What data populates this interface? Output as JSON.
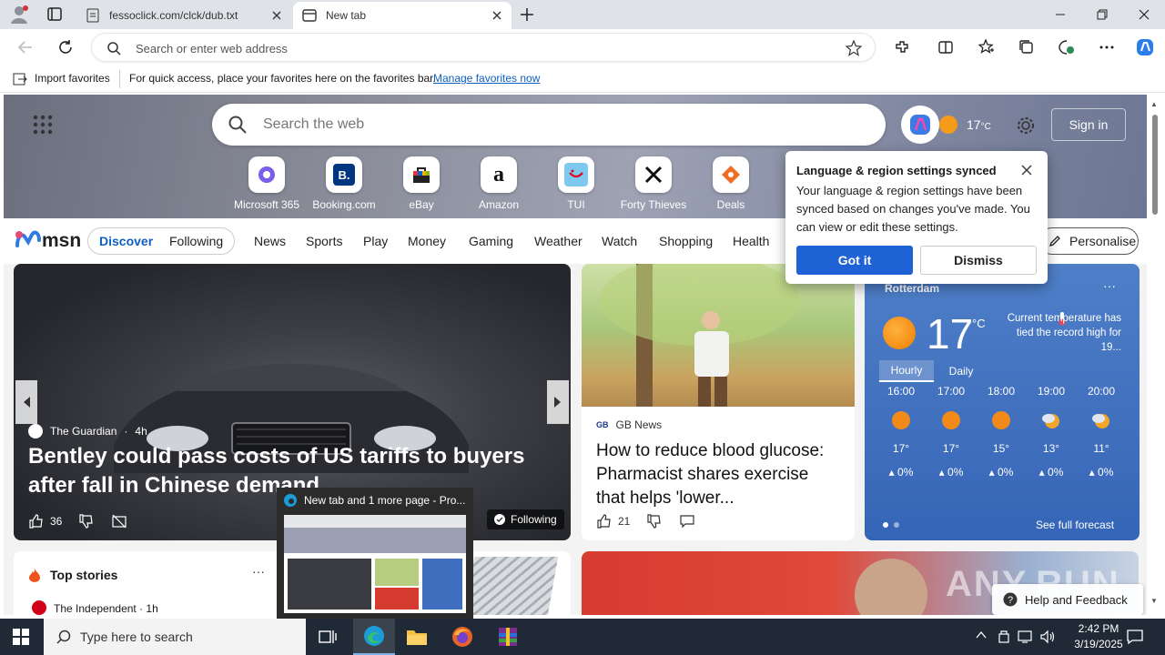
{
  "browser": {
    "tabs": [
      {
        "title": "fessoclick.com/clck/dub.txt",
        "active": false
      },
      {
        "title": "New tab",
        "active": true
      }
    ],
    "address_placeholder": "Search or enter web address",
    "favorites_bar": {
      "import_label": "Import favorites",
      "hint": "For quick access, place your favorites here on the favorites bar.",
      "manage_link": "Manage favorites now"
    }
  },
  "newtab": {
    "search_placeholder": "Search the web",
    "weather_mini": {
      "temp": "17",
      "unit": "°C"
    },
    "sign_in": "Sign in",
    "quick_links": [
      {
        "label": "Microsoft 365",
        "icon": "microsoft365-icon"
      },
      {
        "label": "Booking.com",
        "icon": "booking-icon"
      },
      {
        "label": "eBay",
        "icon": "ebay-icon"
      },
      {
        "label": "Amazon",
        "icon": "amazon-icon"
      },
      {
        "label": "TUI",
        "icon": "tui-icon"
      },
      {
        "label": "Forty Thieves",
        "icon": "forty-thieves-icon"
      },
      {
        "label": "Deals",
        "icon": "deals-icon"
      }
    ],
    "msn": {
      "logo": "msn",
      "segments": [
        "Discover",
        "Following"
      ],
      "nav": [
        "News",
        "Sports",
        "Play",
        "Money",
        "Gaming",
        "Weather",
        "Watch",
        "Shopping",
        "Health"
      ],
      "personalise": "Personalise"
    },
    "hero": {
      "source": "The Guardian",
      "age": "4h",
      "headline": "Bentley could pass costs of US tariffs to buyers after fall in Chinese demand",
      "likes": "36",
      "following": "Following"
    },
    "gb": {
      "source": "GB News",
      "headline": "How to reduce blood glucose: Pharmacist shares exercise that helps 'lower...",
      "likes": "21"
    },
    "weather": {
      "city": "Rotterdam",
      "temp": "17",
      "unit": "°C",
      "note": "Current temperature has tied the record high for 19...",
      "tabs": [
        "Hourly",
        "Daily"
      ],
      "hours": [
        {
          "time": "16:00",
          "temp": "17°",
          "precip": "0%"
        },
        {
          "time": "17:00",
          "temp": "17°",
          "precip": "0%"
        },
        {
          "time": "18:00",
          "temp": "15°",
          "precip": "0%"
        },
        {
          "time": "19:00",
          "temp": "13°",
          "precip": "0%"
        },
        {
          "time": "20:00",
          "temp": "11°",
          "precip": "0%"
        }
      ],
      "see_full": "See full forecast"
    },
    "top_stories": {
      "title": "Top stories",
      "first_source": "The Independent · 1h"
    },
    "help": "Help and Feedback",
    "watermark": "ANY.RUN"
  },
  "popup": {
    "title": "Language & region settings synced",
    "body": "Your language & region settings have been synced based on changes you've made. You can view or edit these settings.",
    "got_it": "Got it",
    "dismiss": "Dismiss"
  },
  "thumbnail": {
    "title": "New tab and 1 more page - Pro..."
  },
  "taskbar": {
    "search_placeholder": "Type here to search",
    "time": "2:42 PM",
    "date": "3/19/2025"
  }
}
